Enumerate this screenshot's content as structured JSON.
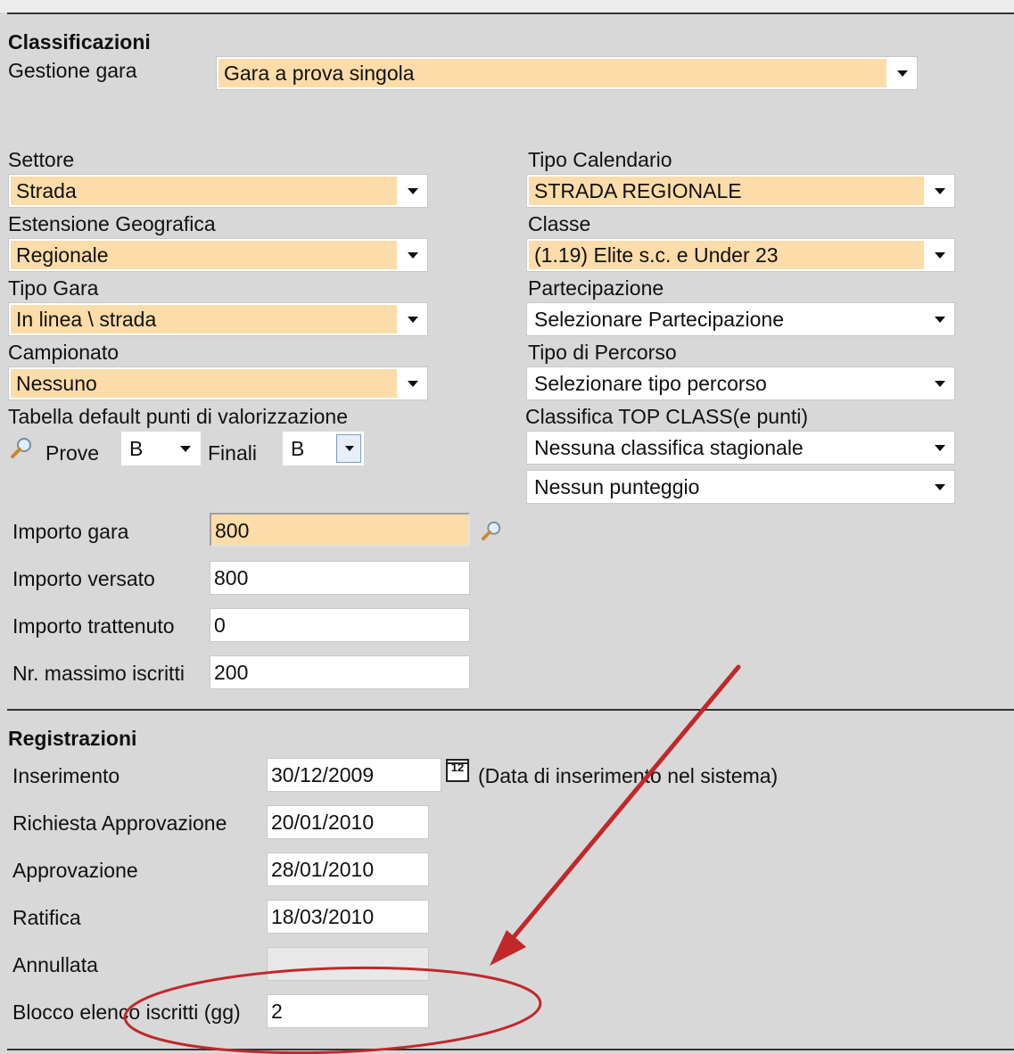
{
  "classificazioni": {
    "title": "Classificazioni",
    "gestione_gara_label": "Gestione gara",
    "gestione_gara_value": "Gara a prova singola",
    "settore_label": "Settore",
    "settore_value": "Strada",
    "estensione_label": "Estensione Geografica",
    "estensione_value": "Regionale",
    "tipo_gara_label": "Tipo Gara",
    "tipo_gara_value": "In linea \\ strada",
    "campionato_label": "Campionato",
    "campionato_value": "Nessuno",
    "tabella_label": "Tabella default punti di valorizzazione",
    "prove_label": "Prove",
    "prove_value": "B",
    "finali_label": "Finali",
    "finali_value": "B",
    "tipo_calendario_label": "Tipo Calendario",
    "tipo_calendario_value": "STRADA REGIONALE",
    "classe_label": "Classe",
    "classe_value": "(1.19) Elite s.c. e Under 23",
    "partecipazione_label": "Partecipazione",
    "partecipazione_value": "Selezionare Partecipazione",
    "tipo_percorso_label": "Tipo di Percorso",
    "tipo_percorso_value": "Selezionare tipo percorso",
    "top_class_label": "Classifica TOP CLASS(e punti)",
    "top_class_value": "Nessuna classifica stagionale",
    "punteggio_value": "Nessun punteggio",
    "importo_gara_label": "Importo gara",
    "importo_gara_value": "800",
    "importo_versato_label": "Importo versato",
    "importo_versato_value": "800",
    "importo_trattenuto_label": "Importo trattenuto",
    "importo_trattenuto_value": "0",
    "max_iscritti_label": "Nr. massimo iscritti",
    "max_iscritti_value": "200"
  },
  "registrazioni": {
    "title": "Registrazioni",
    "inserimento_label": "Inserimento",
    "inserimento_value": "30/12/2009",
    "calendar_day": "12",
    "inserimento_note": "(Data di inserimento nel sistema)",
    "richiesta_label": "Richiesta Approvazione",
    "richiesta_value": "20/01/2010",
    "approvazione_label": "Approvazione",
    "approvazione_value": "28/01/2010",
    "ratifica_label": "Ratifica",
    "ratifica_value": "18/03/2010",
    "annullata_label": "Annullata",
    "annullata_value": "",
    "blocco_label": "Blocco elenco iscritti (gg)",
    "blocco_value": "2"
  },
  "annotation": {
    "color": "#c0282a"
  },
  "colors": {
    "highlight": "#fcdca8",
    "background": "#d8d8d8"
  }
}
